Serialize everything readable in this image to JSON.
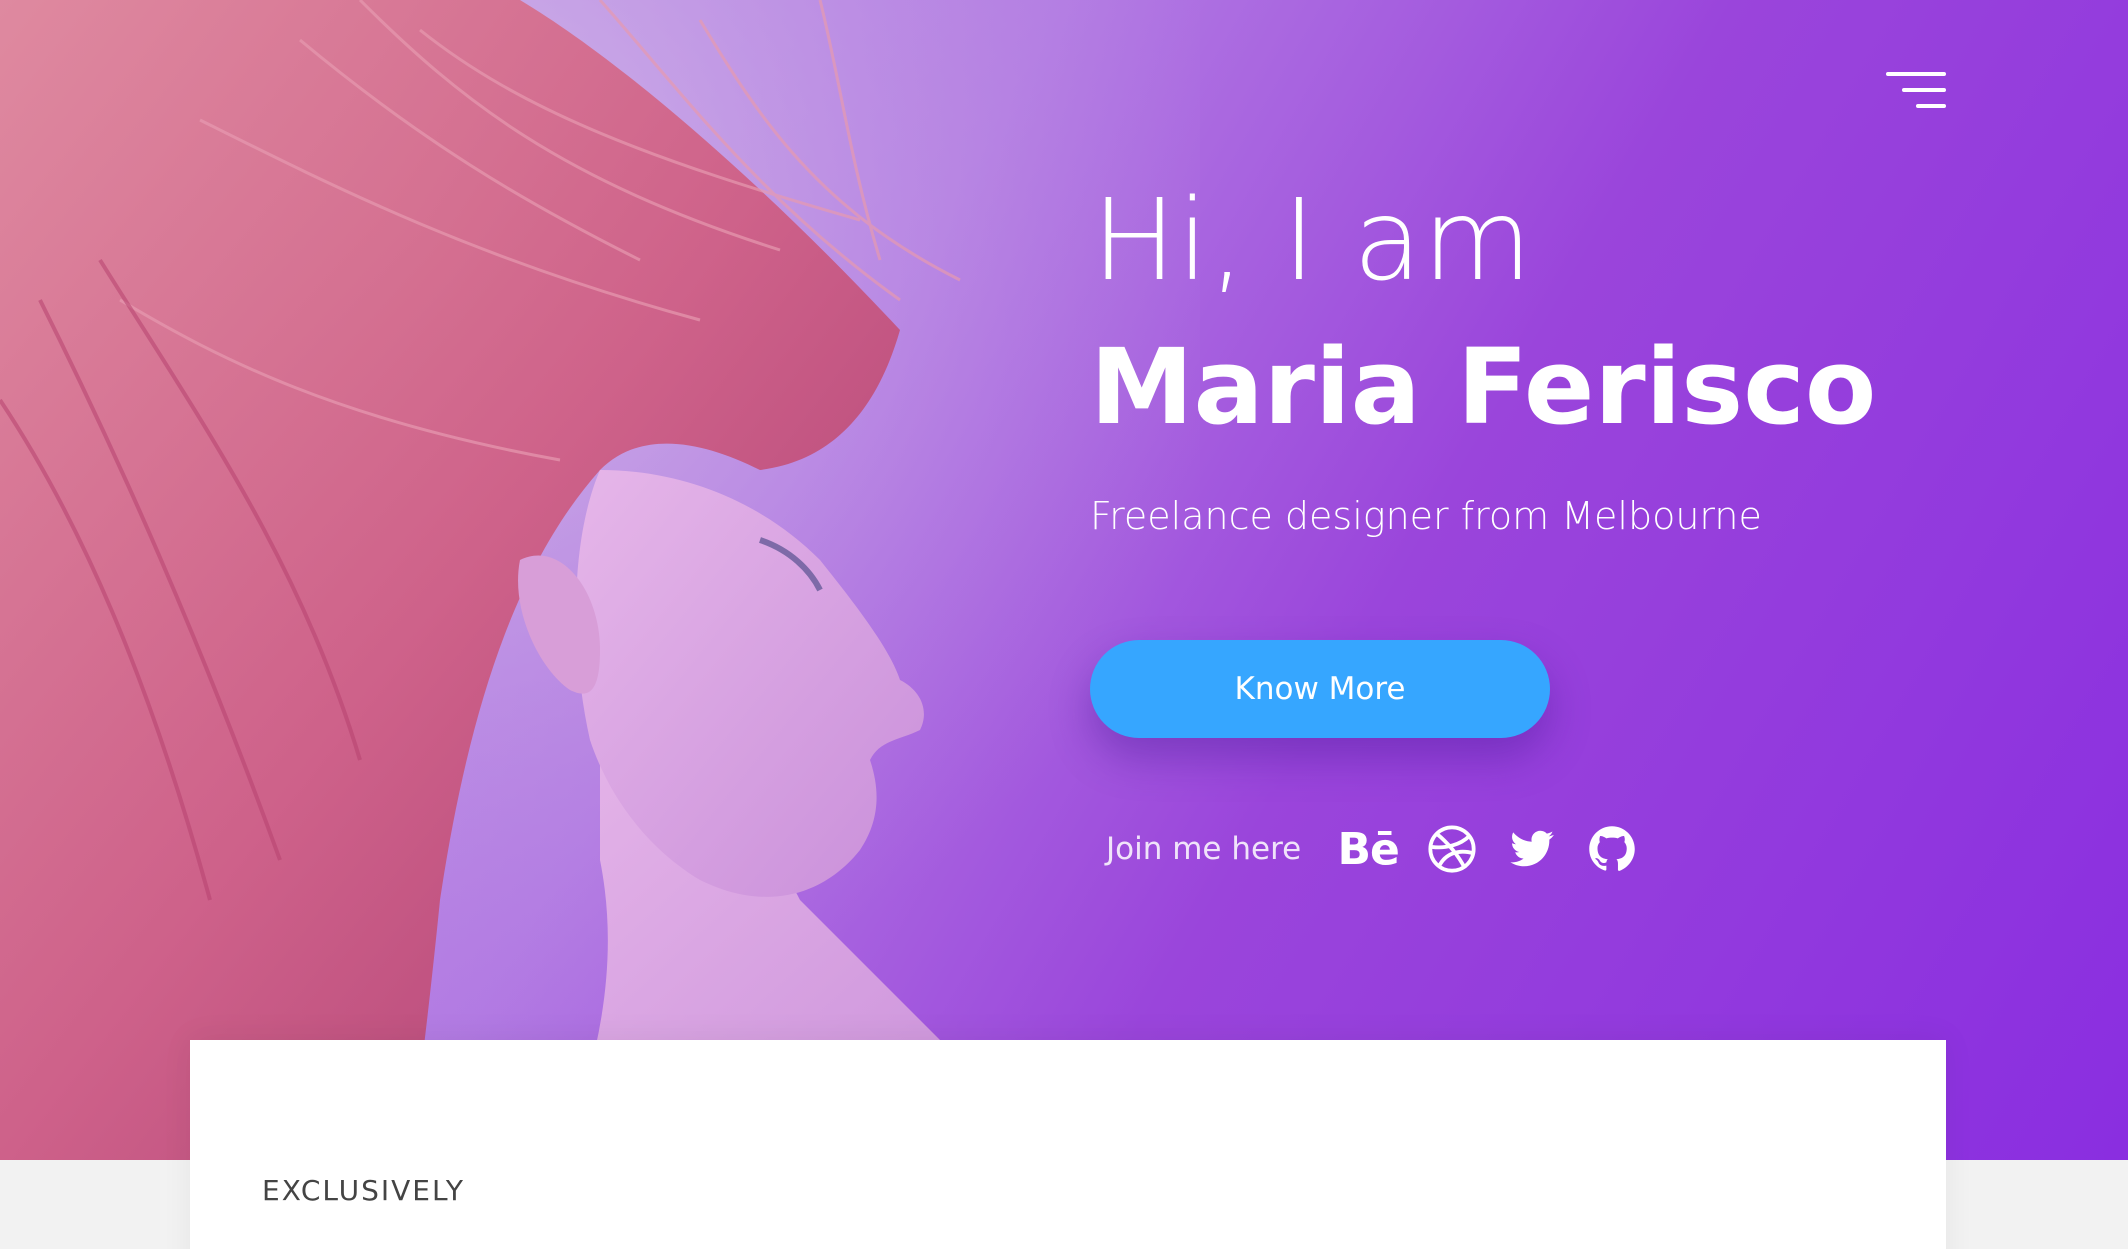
{
  "hero": {
    "greeting": "Hi, I am",
    "name": "Maria Ferisco",
    "tagline": "Freelance designer from Melbourne",
    "cta_label": "Know More",
    "social_label": "Join me here",
    "social_links": [
      "behance-icon",
      "dribbble-icon",
      "twitter-icon",
      "github-icon"
    ],
    "behance_glyph": "Bē"
  },
  "section": {
    "eyebrow": "EXCLUSIVELY"
  },
  "colors": {
    "accent": "#36a6ff",
    "gradient_end": "#8a2ee0"
  }
}
